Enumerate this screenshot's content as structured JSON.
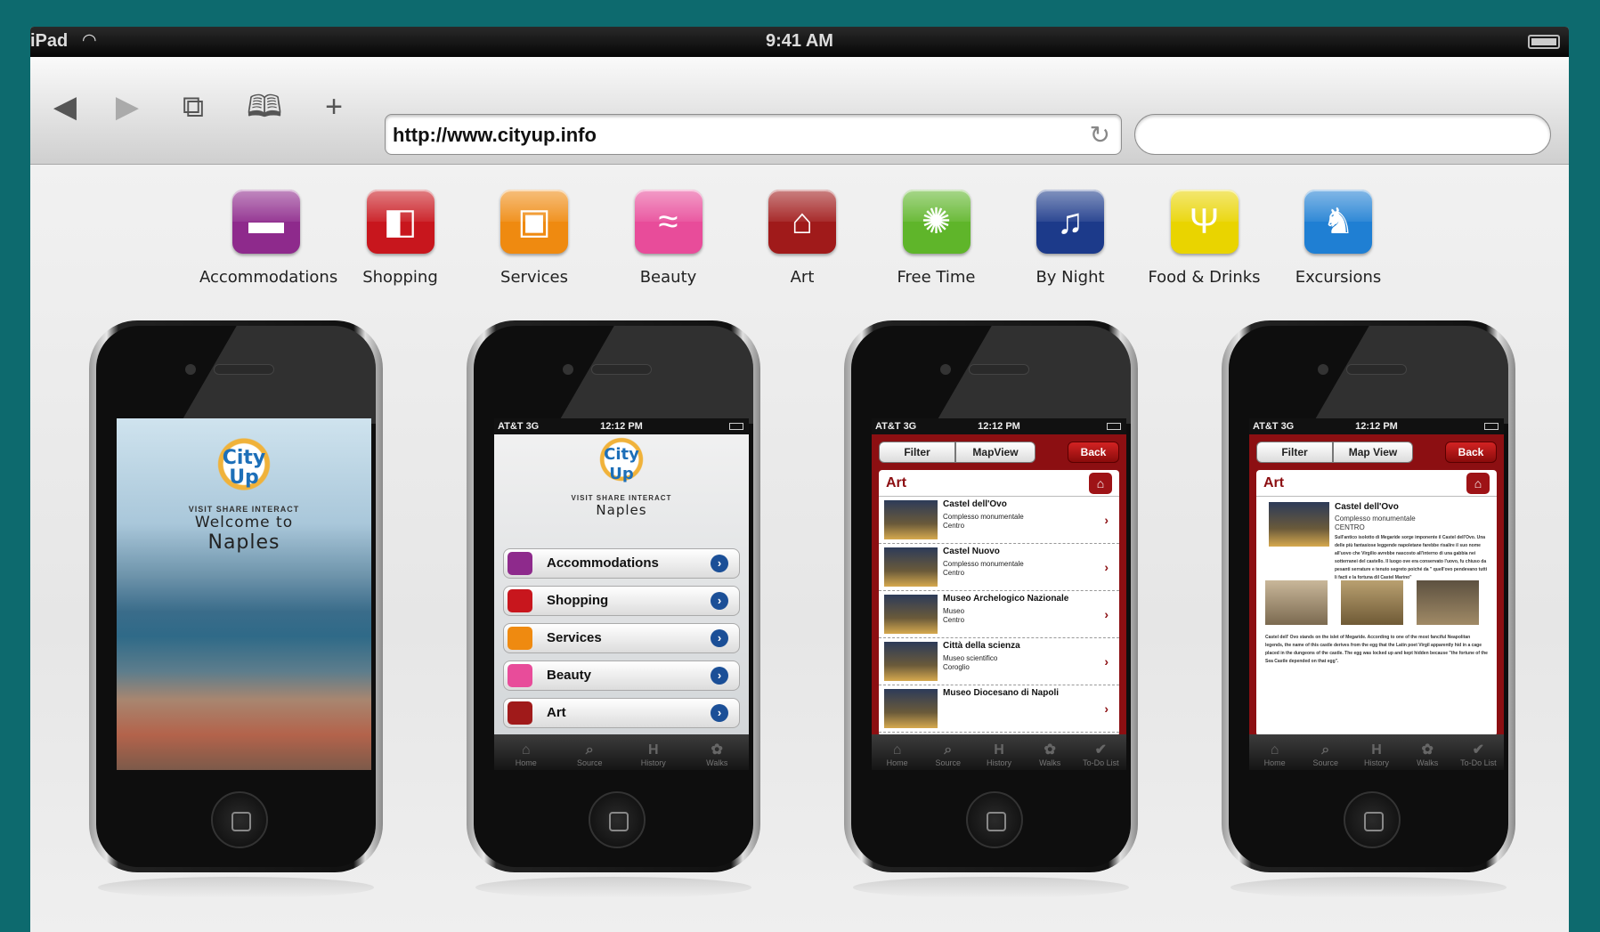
{
  "status_bar": {
    "device": "iPad",
    "time": "9:41 AM"
  },
  "browser": {
    "url": "http://www.cityup.info",
    "search_placeholder": ""
  },
  "categories": [
    {
      "label": "Accommodations",
      "color": "#8e2a8c",
      "glyph": "▬"
    },
    {
      "label": "Shopping",
      "color": "#c8161d",
      "glyph": "◧"
    },
    {
      "label": "Services",
      "color": "#ef8a10",
      "glyph": "▣"
    },
    {
      "label": "Beauty",
      "color": "#e84c9a",
      "glyph": "≈"
    },
    {
      "label": "Art",
      "color": "#a01a1a",
      "glyph": "⌂"
    },
    {
      "label": "Free Time",
      "color": "#5fb52a",
      "glyph": "✺"
    },
    {
      "label": "By Night",
      "color": "#1c3a8a",
      "glyph": "♫"
    },
    {
      "label": "Food & Drinks",
      "color": "#e9d400",
      "glyph": "Ψ"
    },
    {
      "label": "Excursions",
      "color": "#1f7fd3",
      "glyph": "♞"
    }
  ],
  "phone1": {
    "logo": "City Up",
    "tagline": "VISIT SHARE INTERACT",
    "line1": "Welcome to",
    "line2": "Naples"
  },
  "phone2": {
    "carrier": "AT&T 3G",
    "time": "12:12 PM",
    "logo": "City Up",
    "tagline": "VISIT SHARE INTERACT",
    "city": "Naples",
    "items": [
      {
        "label": "Accommodations",
        "color": "#8e2a8c"
      },
      {
        "label": "Shopping",
        "color": "#c8161d"
      },
      {
        "label": "Services",
        "color": "#ef8a10"
      },
      {
        "label": "Beauty",
        "color": "#e84c9a"
      },
      {
        "label": "Art",
        "color": "#a01a1a"
      }
    ],
    "tabs": [
      {
        "icon": "⌂",
        "label": "Home"
      },
      {
        "icon": "⌕",
        "label": "Source"
      },
      {
        "icon": "H",
        "label": "History"
      },
      {
        "icon": "✿",
        "label": "Walks"
      }
    ]
  },
  "phone3": {
    "carrier": "AT&T 3G",
    "time": "12:12 PM",
    "filter": "Filter",
    "mapview": "MapView",
    "back": "Back",
    "section": "Art",
    "rows": [
      {
        "title": "Castel dell'Ovo",
        "sub": "Complesso monumentale",
        "area": "Centro"
      },
      {
        "title": "Castel Nuovo",
        "sub": "Complesso monumentale",
        "area": "Centro"
      },
      {
        "title": "Museo Archelogico Nazionale",
        "sub": "Museo",
        "area": "Centro"
      },
      {
        "title": "Città della scienza",
        "sub": "Museo scientifico",
        "area": "Coroglio"
      },
      {
        "title": "Museo Diocesano di Napoli",
        "sub": "",
        "area": ""
      }
    ],
    "tabs": [
      {
        "icon": "⌂",
        "label": "Home"
      },
      {
        "icon": "⌕",
        "label": "Source"
      },
      {
        "icon": "H",
        "label": "History"
      },
      {
        "icon": "✿",
        "label": "Walks"
      },
      {
        "icon": "✔",
        "label": "To-Do List"
      }
    ]
  },
  "phone4": {
    "carrier": "AT&T 3G",
    "time": "12:12 PM",
    "filter": "Filter",
    "mapview": "Map View",
    "back": "Back",
    "section": "Art",
    "title": "Castel dell'Ovo",
    "sub": "Complesso monumentale",
    "area": "CENTRO",
    "text_it": "Sull'antico isolotto di Megaride sorge imponente il Castel dell'Ovo. Una delle più fantasiose leggende napoletane farebbe risalire il suo nome all'uovo che Virgilio avrebbe nascosto all'interno di una gabbia nei sotterranei del castello. Il luogo ove era conservato l'uovo, fu chiuso da pesanti serrature e tenuto segreto poiché da \" quell'ovo pendevano tutti li facti e la fortuna dil Castel Marino\"",
    "text_en": "Castel dell' Ovo stands on the islet of Megaride. According to one of the most fanciful Neapolitan legends, the name of this castle derives from the egg that the Latin poet Virgil apparently hid in a cage placed in the dungeons of the castle. The egg was locked up and kept hidden because \"the fortune of the Sea Castle depended on that egg\".",
    "tabs": [
      {
        "icon": "⌂",
        "label": "Home"
      },
      {
        "icon": "⌕",
        "label": "Source"
      },
      {
        "icon": "H",
        "label": "History"
      },
      {
        "icon": "✿",
        "label": "Walks"
      },
      {
        "icon": "✔",
        "label": "To-Do List"
      }
    ]
  }
}
